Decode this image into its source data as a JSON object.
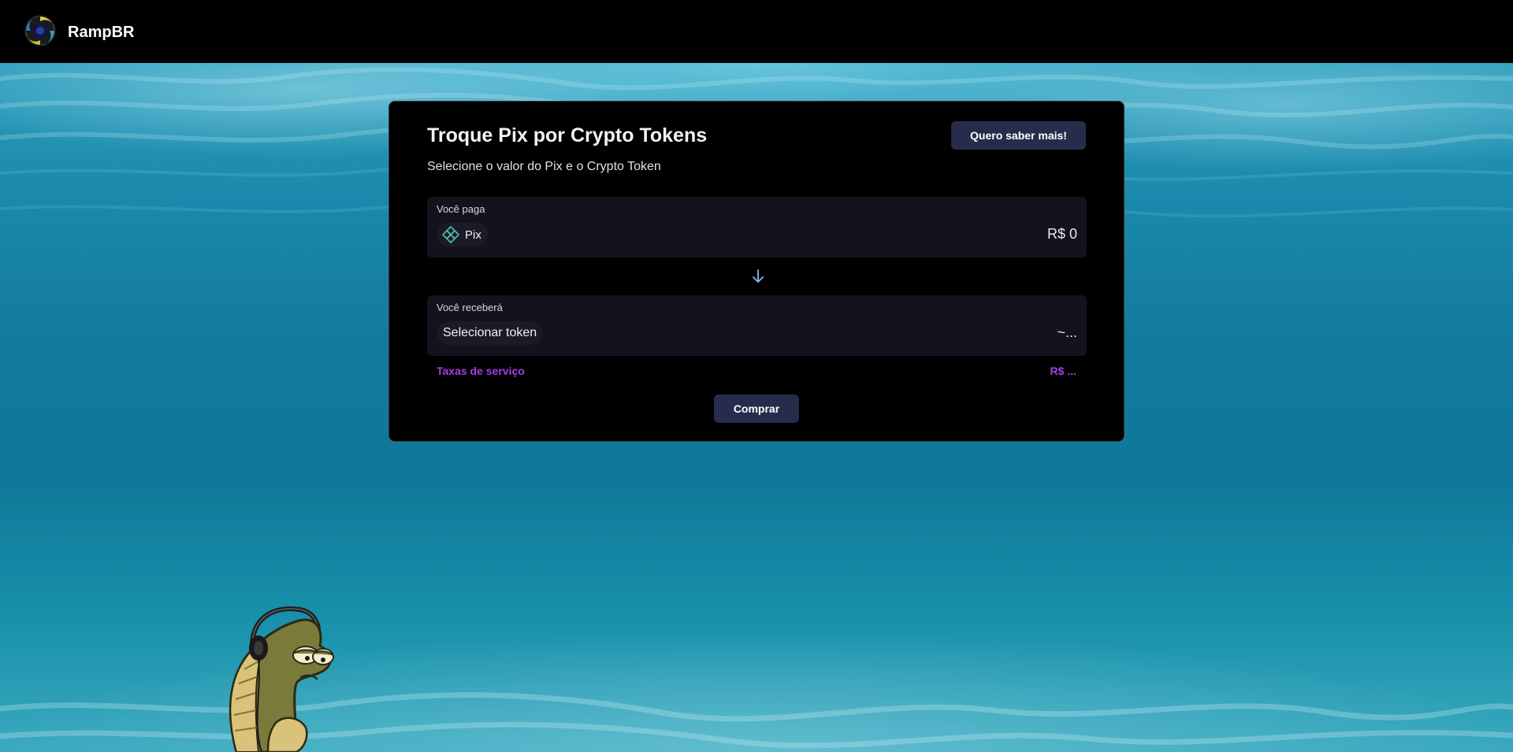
{
  "header": {
    "brand": "RampBR",
    "logo_icon": "spiral-logo-icon"
  },
  "colors": {
    "accent_purple": "#a53ee6",
    "button_bg": "#282c4c",
    "panel_bg": "#13131d",
    "pix_teal": "#4fbfae",
    "arrow_blue": "#8ab4ff"
  },
  "card": {
    "title": "Troque Pix por Crypto Tokens",
    "subtitle": "Selecione o valor do Pix e o Crypto Token",
    "learn_more_label": "Quero saber mais!",
    "pay": {
      "label": "Você paga",
      "asset_icon": "pix-icon",
      "asset_name": "Pix",
      "amount": "R$ 0"
    },
    "swap_icon": "arrow-down-icon",
    "receive": {
      "label": "Você receberá",
      "select_token_label": "Selecionar token",
      "amount": "~..."
    },
    "fees": {
      "label": "Taxas de serviço",
      "value": "R$ ..."
    },
    "buy_label": "Comprar"
  },
  "background": {
    "scene": "underwater",
    "mascot_icon": "fish-with-headphones-icon"
  }
}
